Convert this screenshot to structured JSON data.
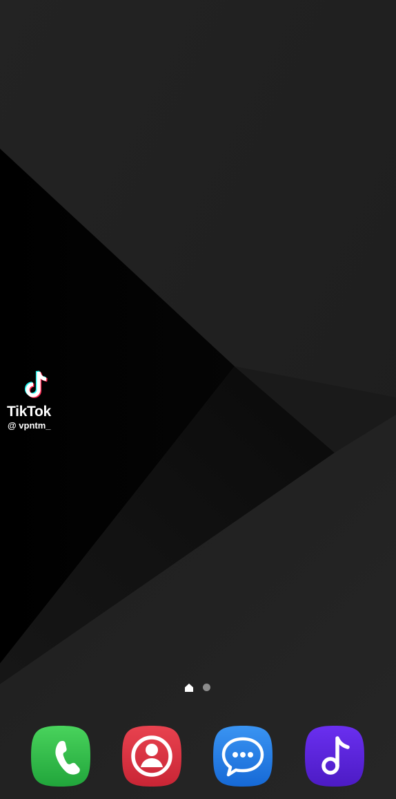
{
  "watermark": {
    "brand": "TikTok",
    "handle": "@ vpntm_"
  },
  "page_indicator": {
    "pages": 2,
    "current_page": 1,
    "home_icon": "home-icon"
  },
  "dock": {
    "apps": [
      {
        "id": "phone",
        "icon": "phone-handset-icon",
        "color": "#2fb84a"
      },
      {
        "id": "contacts",
        "icon": "person-icon",
        "color": "#d9323f"
      },
      {
        "id": "messages",
        "icon": "chat-bubble-icon",
        "color": "#1f7ee8"
      },
      {
        "id": "music",
        "icon": "music-note-icon",
        "color": "#5b24d8"
      }
    ]
  },
  "colors": {
    "wallpaper_base": "#222222",
    "wallpaper_dark": "#000000",
    "tiktok_cyan": "#25f4ee",
    "tiktok_red": "#fe2c55"
  }
}
